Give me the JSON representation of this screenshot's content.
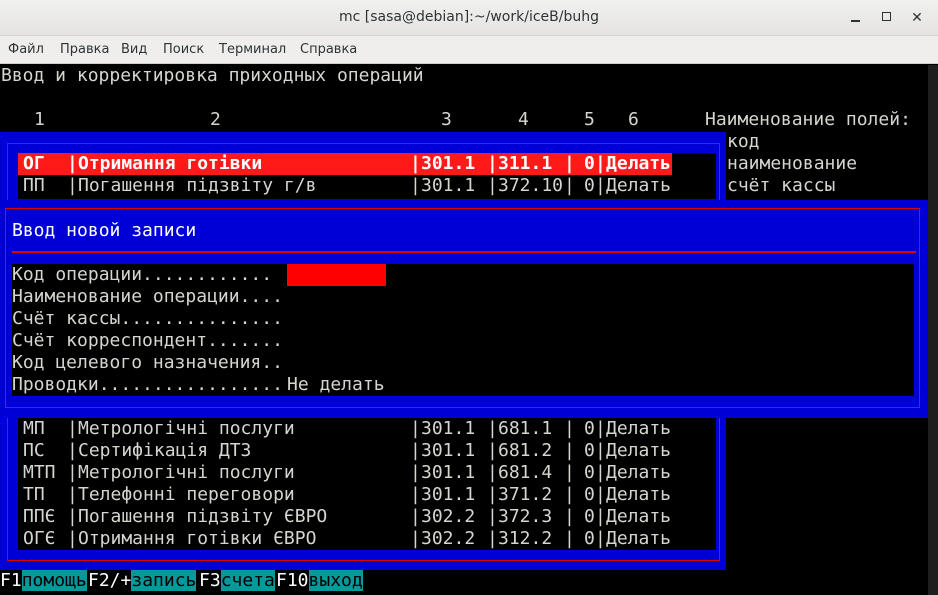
{
  "window": {
    "title": "mc [sasa@debian]:~/work/iceB/buhg",
    "minimize": "minimize",
    "maximize": "maximize",
    "close": "✕"
  },
  "menu": [
    "Файл",
    "Правка",
    "Вид",
    "Поиск",
    "Терминал",
    "Справка"
  ],
  "screen": {
    "heading": "Ввод и корректировка приходных операций",
    "column_numbers": [
      "1",
      "2",
      "3",
      "4",
      "5",
      "6"
    ],
    "fields_title": "Наименование полей:",
    "field_names": [
      "код",
      "наименование",
      "счёт кассы"
    ]
  },
  "table": {
    "rows_top": [
      {
        "code": "ОГ",
        "name": "Отримання готівки",
        "acc": "301.1",
        "corr": "311.1",
        "n": "0",
        "act": "Делать",
        "selected": true
      },
      {
        "code": "ПП",
        "name": "Погашення підзвіту г/в",
        "acc": "301.1",
        "corr": "372.10",
        "n": "0",
        "act": "Делать",
        "selected": false
      }
    ],
    "rows_bottom": [
      {
        "code": "МП",
        "name": "Метрологічні послуги",
        "acc": "301.1",
        "corr": "681.1",
        "n": "0",
        "act": "Делать"
      },
      {
        "code": "ПС",
        "name": "Сертифікація ДТЗ",
        "acc": "301.1",
        "corr": "681.2",
        "n": "0",
        "act": "Делать"
      },
      {
        "code": "МТП",
        "name": "Метрологічні послуги",
        "acc": "301.1",
        "corr": "681.4",
        "n": "0",
        "act": "Делать"
      },
      {
        "code": "ТП",
        "name": "Телефонні переговори",
        "acc": "301.1",
        "corr": "371.2",
        "n": "0",
        "act": "Делать"
      },
      {
        "code": "ППЄ",
        "name": "Погашення підзвіту ЄВРО",
        "acc": "302.2",
        "corr": "372.3",
        "n": "0",
        "act": "Делать"
      },
      {
        "code": "ОГЄ",
        "name": "Отримання готівки ЄВРО",
        "acc": "302.2",
        "corr": "312.2",
        "n": "0",
        "act": "Делать"
      }
    ]
  },
  "dialog": {
    "title": "Ввод новой записи",
    "fields": [
      {
        "label": "Код операции............",
        "value": ""
      },
      {
        "label": "Наименование операции....",
        "value": ""
      },
      {
        "label": "Счёт кассы...............",
        "value": ""
      },
      {
        "label": "Счёт корреспондент.......",
        "value": ""
      },
      {
        "label": "Код целевого назначения..",
        "value": ""
      },
      {
        "label": "Проводки.................",
        "value": "Не делать"
      }
    ]
  },
  "function_keys": [
    {
      "key": "F1",
      "label": "помощь"
    },
    {
      "key": "F2/+",
      "label": "запись"
    },
    {
      "key": "F3",
      "label": "счета"
    },
    {
      "key": "F10",
      "label": "выход"
    }
  ]
}
